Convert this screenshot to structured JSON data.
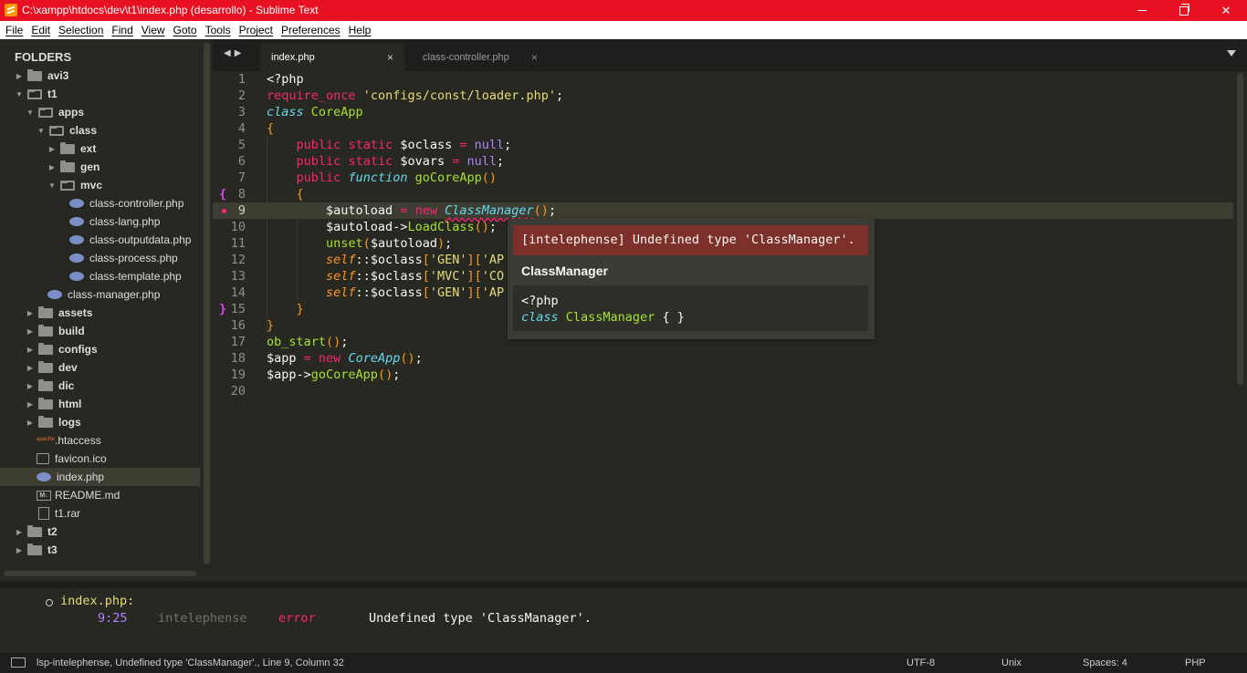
{
  "window": {
    "title": "C:\\xampp\\htdocs\\dev\\t1\\index.php (desarrollo) - Sublime Text"
  },
  "menu": [
    "File",
    "Edit",
    "Selection",
    "Find",
    "View",
    "Goto",
    "Tools",
    "Project",
    "Preferences",
    "Help"
  ],
  "sidebar": {
    "title": "FOLDERS",
    "items": [
      {
        "label": "avi3",
        "type": "folder",
        "depth": 0,
        "arrow": "▶"
      },
      {
        "label": "t1",
        "type": "folder-open",
        "depth": 0,
        "arrow": "▼"
      },
      {
        "label": "apps",
        "type": "folder-open",
        "depth": 1,
        "arrow": "▼"
      },
      {
        "label": "class",
        "type": "folder-open",
        "depth": 2,
        "arrow": "▼"
      },
      {
        "label": "ext",
        "type": "folder",
        "depth": 3,
        "arrow": "▶"
      },
      {
        "label": "gen",
        "type": "folder",
        "depth": 3,
        "arrow": "▶"
      },
      {
        "label": "mvc",
        "type": "folder-open",
        "depth": 3,
        "arrow": "▼"
      },
      {
        "label": "class-controller.php",
        "type": "php",
        "depth": 4,
        "arrow": ""
      },
      {
        "label": "class-lang.php",
        "type": "php",
        "depth": 4,
        "arrow": ""
      },
      {
        "label": "class-outputdata.php",
        "type": "php",
        "depth": 4,
        "arrow": ""
      },
      {
        "label": "class-process.php",
        "type": "php",
        "depth": 4,
        "arrow": ""
      },
      {
        "label": "class-template.php",
        "type": "php",
        "depth": 4,
        "arrow": ""
      },
      {
        "label": "class-manager.php",
        "type": "php",
        "depth": 3,
        "arrow": ""
      },
      {
        "label": "assets",
        "type": "folder",
        "depth": 1,
        "arrow": "▶"
      },
      {
        "label": "build",
        "type": "folder",
        "depth": 1,
        "arrow": "▶"
      },
      {
        "label": "configs",
        "type": "folder",
        "depth": 1,
        "arrow": "▶"
      },
      {
        "label": "dev",
        "type": "folder",
        "depth": 1,
        "arrow": "▶"
      },
      {
        "label": "dic",
        "type": "folder",
        "depth": 1,
        "arrow": "▶"
      },
      {
        "label": "html",
        "type": "folder",
        "depth": 1,
        "arrow": "▶"
      },
      {
        "label": "logs",
        "type": "folder",
        "depth": 1,
        "arrow": "▶"
      },
      {
        "label": ".htaccess",
        "type": "htaccess",
        "depth": 2,
        "arrow": ""
      },
      {
        "label": "favicon.ico",
        "type": "ico",
        "depth": 2,
        "arrow": ""
      },
      {
        "label": "index.php",
        "type": "php",
        "depth": 2,
        "arrow": "",
        "selected": true
      },
      {
        "label": "README.md",
        "type": "md",
        "depth": 2,
        "arrow": ""
      },
      {
        "label": "t1.rar",
        "type": "file",
        "depth": 2,
        "arrow": ""
      },
      {
        "label": "t2",
        "type": "folder",
        "depth": 0,
        "arrow": "▶"
      },
      {
        "label": "t3",
        "type": "folder",
        "depth": 0,
        "arrow": "▶"
      }
    ]
  },
  "tabs": [
    {
      "label": "index.php",
      "active": true
    },
    {
      "label": "class-controller.php",
      "active": false
    }
  ],
  "editor": {
    "current_line": 9,
    "lines": [
      {
        "n": "1",
        "tokens": [
          [
            "",
            "<?php"
          ]
        ]
      },
      {
        "n": "2",
        "tokens": [
          [
            "kw",
            "require_once"
          ],
          [
            "",
            " "
          ],
          [
            "str",
            "'configs/const/loader.php'"
          ],
          [
            "",
            ";"
          ]
        ]
      },
      {
        "n": "3",
        "tokens": [
          [
            "type",
            "class"
          ],
          [
            "",
            " "
          ],
          [
            "cls",
            "CoreApp"
          ]
        ]
      },
      {
        "n": "4",
        "tokens": [
          [
            "br",
            "{"
          ]
        ]
      },
      {
        "n": "5",
        "tokens": [
          [
            "",
            "    "
          ],
          [
            "kw",
            "public"
          ],
          [
            "",
            " "
          ],
          [
            "kw",
            "static"
          ],
          [
            "",
            " $oclass "
          ],
          [
            "kw",
            "="
          ],
          [
            "",
            " "
          ],
          [
            "const",
            "null"
          ],
          [
            "",
            ";"
          ]
        ]
      },
      {
        "n": "6",
        "tokens": [
          [
            "",
            "    "
          ],
          [
            "kw",
            "public"
          ],
          [
            "",
            " "
          ],
          [
            "kw",
            "static"
          ],
          [
            "",
            " $ovars "
          ],
          [
            "kw",
            "="
          ],
          [
            "",
            " "
          ],
          [
            "const",
            "null"
          ],
          [
            "",
            ";"
          ]
        ]
      },
      {
        "n": "7",
        "tokens": [
          [
            "",
            "    "
          ],
          [
            "kw",
            "public"
          ],
          [
            "",
            " "
          ],
          [
            "type",
            "function"
          ],
          [
            "",
            " "
          ],
          [
            "fn",
            "goCoreApp"
          ],
          [
            "br",
            "()"
          ]
        ]
      },
      {
        "n": "8",
        "mark": "{",
        "tokens": [
          [
            "",
            "    "
          ],
          [
            "br",
            "{"
          ]
        ]
      },
      {
        "n": "9",
        "dot": true,
        "tokens": [
          [
            "",
            "        $autoload "
          ],
          [
            "kw",
            "="
          ],
          [
            "",
            " "
          ],
          [
            "kw",
            "new"
          ],
          [
            "",
            " "
          ],
          [
            "err",
            "ClassManager"
          ],
          [
            "br",
            "()"
          ],
          [
            "",
            ";"
          ]
        ]
      },
      {
        "n": "10",
        "tokens": [
          [
            "",
            "        $autoload->"
          ],
          [
            "fn",
            "LoadClass"
          ],
          [
            "br",
            "()"
          ],
          [
            "",
            ";"
          ]
        ]
      },
      {
        "n": "11",
        "tokens": [
          [
            "",
            "        "
          ],
          [
            "fn",
            "unset"
          ],
          [
            "br",
            "("
          ],
          [
            "",
            "$autoload"
          ],
          [
            "br",
            ")"
          ],
          [
            "",
            ";"
          ]
        ]
      },
      {
        "n": "12",
        "tokens": [
          [
            "",
            "        "
          ],
          [
            "self",
            "self"
          ],
          [
            "",
            "::$oclass"
          ],
          [
            "br",
            "["
          ],
          [
            "str",
            "'GEN'"
          ],
          [
            "br",
            "]["
          ],
          [
            "str",
            "'AP"
          ]
        ]
      },
      {
        "n": "13",
        "tokens": [
          [
            "",
            "        "
          ],
          [
            "self",
            "self"
          ],
          [
            "",
            "::$oclass"
          ],
          [
            "br",
            "["
          ],
          [
            "str",
            "'MVC'"
          ],
          [
            "br",
            "]["
          ],
          [
            "str",
            "'CO"
          ]
        ]
      },
      {
        "n": "14",
        "tokens": [
          [
            "",
            "        "
          ],
          [
            "self",
            "self"
          ],
          [
            "",
            "::$oclass"
          ],
          [
            "br",
            "["
          ],
          [
            "str",
            "'GEN'"
          ],
          [
            "br",
            "]["
          ],
          [
            "str",
            "'AP"
          ]
        ]
      },
      {
        "n": "15",
        "mark": "}",
        "tokens": [
          [
            "",
            "    "
          ],
          [
            "br",
            "}"
          ]
        ]
      },
      {
        "n": "16",
        "tokens": [
          [
            "br",
            "}"
          ]
        ]
      },
      {
        "n": "17",
        "tokens": [
          [
            "fn",
            "ob_start"
          ],
          [
            "br",
            "()"
          ],
          [
            "",
            ";"
          ]
        ]
      },
      {
        "n": "18",
        "tokens": [
          [
            "",
            "$app "
          ],
          [
            "kw",
            "="
          ],
          [
            "",
            " "
          ],
          [
            "kw",
            "new"
          ],
          [
            "",
            " "
          ],
          [
            "type",
            "CoreApp"
          ],
          [
            "br",
            "()"
          ],
          [
            "",
            ";"
          ]
        ]
      },
      {
        "n": "19",
        "tokens": [
          [
            "",
            "$app->"
          ],
          [
            "fn",
            "goCoreApp"
          ],
          [
            "br",
            "()"
          ],
          [
            "",
            ";"
          ]
        ]
      },
      {
        "n": "20",
        "tokens": []
      }
    ]
  },
  "popup": {
    "error": "[intelephense] Undefined type 'ClassManager'.",
    "title": "ClassManager",
    "code_line1": "<?php",
    "code_kw": "class",
    "code_name": "ClassManager",
    "code_rest": " { }"
  },
  "panel": {
    "file": "index.php:",
    "position": "9:25",
    "source": "intelephense",
    "severity": "error",
    "message": "Undefined type 'ClassManager'."
  },
  "status": {
    "message": "lsp-intelephense, Undefined type 'ClassManager'., Line 9, Column 32",
    "encoding": "UTF-8",
    "line_endings": "Unix",
    "indent": "Spaces: 4",
    "syntax": "PHP"
  },
  "colors": {
    "titlebar": "#e81123",
    "background": "#272822",
    "keyword": "#f92672",
    "string": "#e6db74"
  }
}
